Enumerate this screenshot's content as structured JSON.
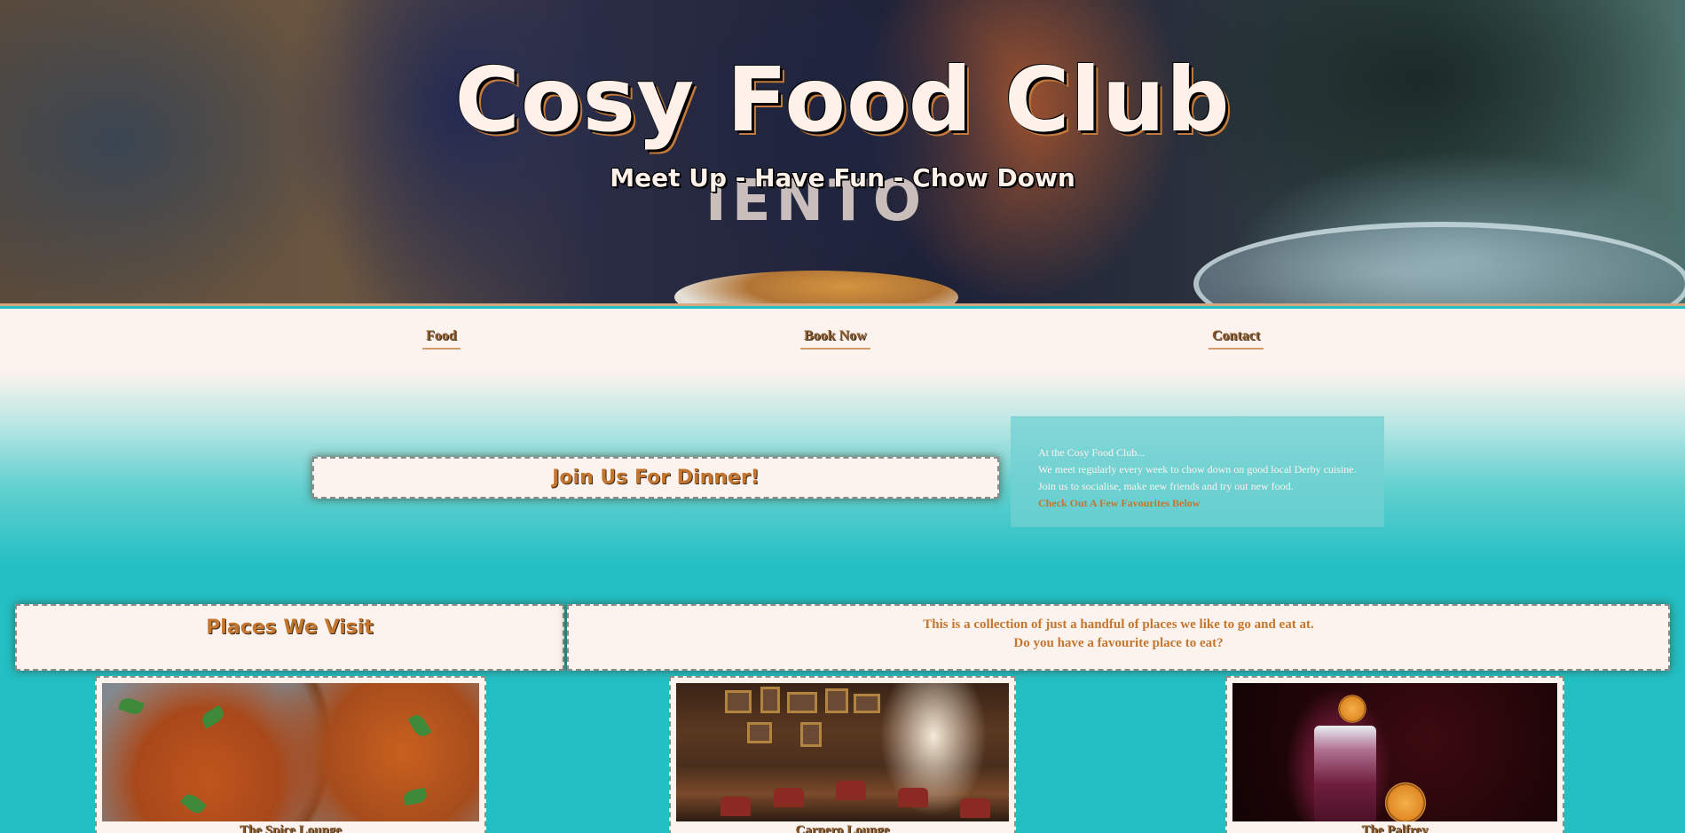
{
  "hero": {
    "title": "Cosy Food Club",
    "subtitle": "Meet Up - Have Fun - Chow Down"
  },
  "nav": {
    "items": [
      {
        "label": "Food"
      },
      {
        "label": "Book Now"
      },
      {
        "label": "Contact"
      }
    ]
  },
  "intro": {
    "join_heading": "Join Us For Dinner!",
    "about_lines": [
      "At the Cosy Food Club...",
      "We meet regularly every week to chow down on good local Derby cuisine.",
      "Join us to socialise, make new friends and try out new food."
    ],
    "about_link": "Check Out A Few Favourites Below"
  },
  "places": {
    "heading": "Places We Visit",
    "description_lines": [
      "This is a collection of just a handful of places we like to go and eat at.",
      "Do you have a favourite place to eat?"
    ],
    "cards": [
      {
        "name": "The Spice Lounge"
      },
      {
        "name": "Carnero Lounge"
      },
      {
        "name": "The Palfrey"
      }
    ]
  },
  "colors": {
    "background_teal": "#23bfc4",
    "cream": "#fdf3ee",
    "accent_orange": "#c4762e",
    "nav_brown": "#8a5a2a"
  }
}
